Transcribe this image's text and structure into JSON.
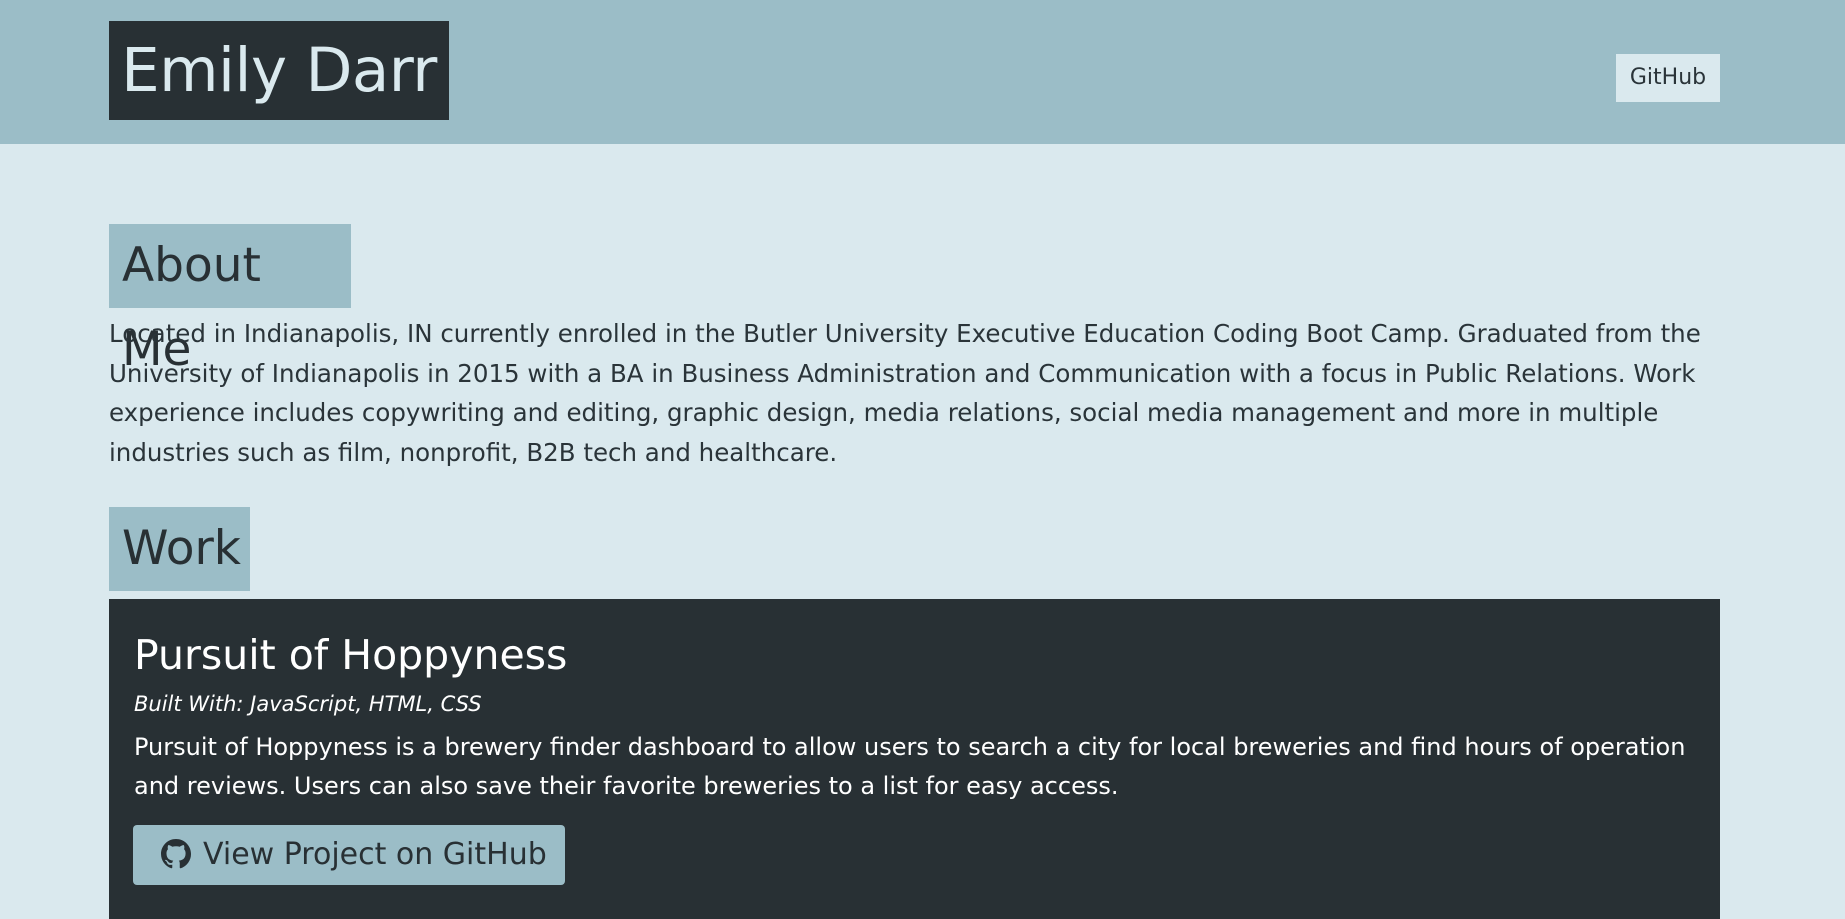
{
  "header": {
    "brand": "Emily Darr",
    "nav_link": "GitHub"
  },
  "about": {
    "heading": "About Me",
    "paragraph": "Located in Indianapolis, IN currently enrolled in the Butler University Executive Education Coding Boot Camp. Graduated from the University of Indianapolis in 2015 with a BA in Business Administration and Communication with a focus in Public Relations. Work experience includes copywriting and editing, graphic design, media relations, social media management and more in multiple industries such as film, nonprofit, B2B tech and healthcare."
  },
  "work": {
    "heading": "Work",
    "projects": [
      {
        "title": "Pursuit of Hoppyness",
        "built_with": "Built With: JavaScript, HTML, CSS",
        "description": "Pursuit of Hoppyness is a brewery finder dashboard to allow users to search a city for local breweries and find hours of operation and reviews. Users can also save their favorite breweries to a list for easy access.",
        "button_label": "View Project on GitHub",
        "button_icon": "github-icon"
      }
    ]
  },
  "colors": {
    "page_background": "#dae9ee",
    "header_background": "#9bbdc7",
    "dark": "#283034",
    "text": "#2a3439"
  }
}
